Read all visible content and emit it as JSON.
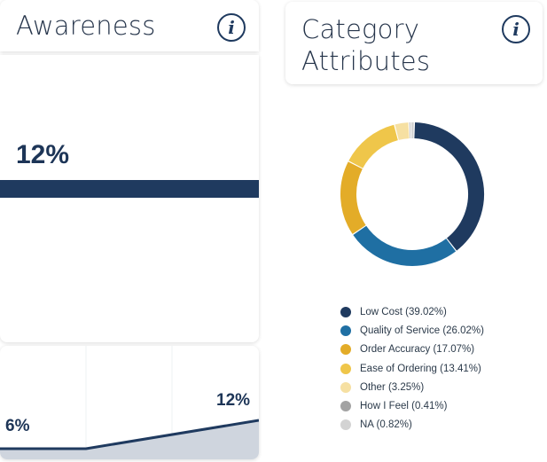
{
  "awareness": {
    "title": "Awareness",
    "info_icon": "info-icon",
    "value_label": "12%",
    "value_fraction": 0.12,
    "trend": {
      "start_label": "6%",
      "end_label": "12%",
      "start_value": 6,
      "end_value": 12
    }
  },
  "category": {
    "title": "Category Attributes",
    "info_icon": "info-icon"
  },
  "colors": {
    "navy": "#1f3a5f",
    "trend_fill": "#cfd5de"
  },
  "chart_data": {
    "type": "pie",
    "donut": true,
    "slices": [
      {
        "label": "Low Cost (39.02%)",
        "value": 39.02,
        "color": "#1f3a5f"
      },
      {
        "label": "Quality of Service (26.02%)",
        "value": 26.02,
        "color": "#1f6fa3"
      },
      {
        "label": "Order Accuracy (17.07%)",
        "value": 17.07,
        "color": "#e3ac28"
      },
      {
        "label": "Ease of Ordering (13.41%)",
        "value": 13.41,
        "color": "#efc64a"
      },
      {
        "label": "Other (3.25%)",
        "value": 3.25,
        "color": "#f6e0a2"
      },
      {
        "label": "How I Feel (0.41%)",
        "value": 0.41,
        "color": "#a3a3a3"
      },
      {
        "label": "NA (0.82%)",
        "value": 0.82,
        "color": "#d3d3d3"
      }
    ],
    "legend_position": "bottom"
  }
}
